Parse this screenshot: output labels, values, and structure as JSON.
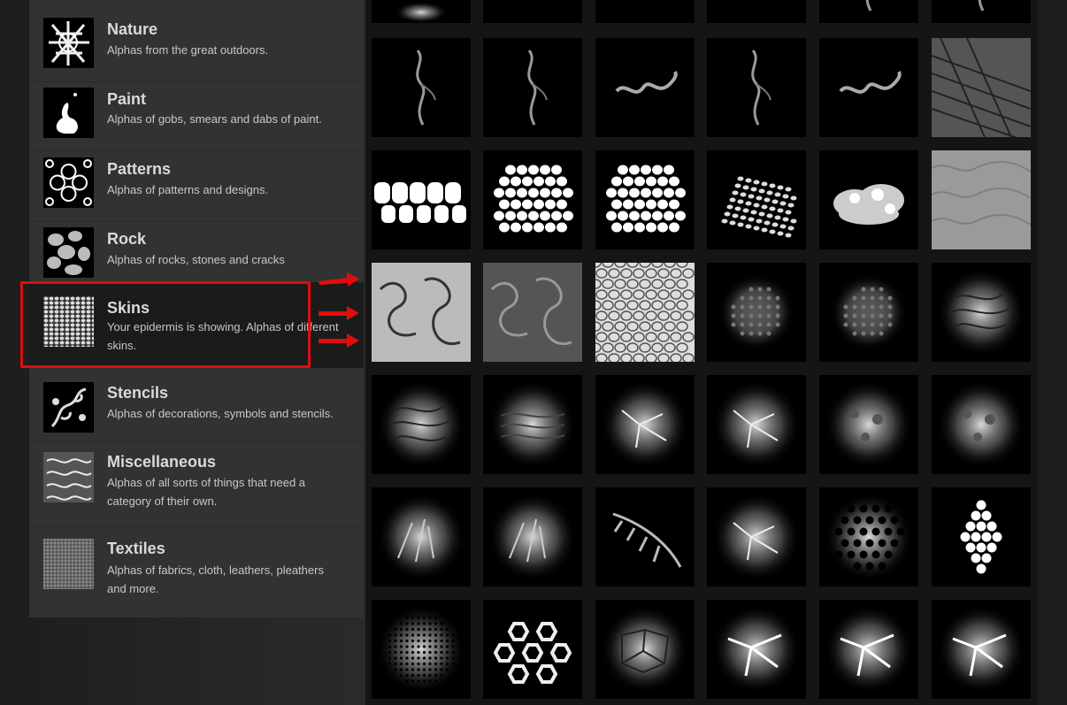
{
  "categories": [
    {
      "id": "nature",
      "title": "Nature",
      "desc": "Alphas from the great outdoors.",
      "icon": "nature-thumb"
    },
    {
      "id": "paint",
      "title": "Paint",
      "desc": "Alphas of gobs, smears and dabs of paint.",
      "icon": "paint-thumb"
    },
    {
      "id": "patterns",
      "title": "Patterns",
      "desc": "Alphas of patterns and designs.",
      "icon": "patterns-thumb"
    },
    {
      "id": "rock",
      "title": "Rock",
      "desc": "Alphas of rocks, stones and cracks",
      "icon": "rock-thumb"
    },
    {
      "id": "skins",
      "title": "Skins",
      "desc": "Your epidermis is showing. Alphas of different skins.",
      "icon": "skins-thumb",
      "selected": true
    },
    {
      "id": "stencils",
      "title": "Stencils",
      "desc": "Alphas of decorations, symbols and stencils.",
      "icon": "stencils-thumb"
    },
    {
      "id": "misc",
      "title": "Miscellaneous",
      "desc": "Alphas of all sorts of things that need a category of their own.",
      "icon": "misc-thumb"
    },
    {
      "id": "textiles",
      "title": "Textiles",
      "desc": "Alphas of fabrics, cloth, leathers, pleathers and more.",
      "icon": "textiles-thumb"
    }
  ],
  "annotation": {
    "highlight_color": "#e00d0d",
    "arrow_color": "#e00d0d",
    "arrow_count": 3
  },
  "grid": {
    "columns": 6,
    "rows": [
      [
        "glow",
        "blank",
        "blank",
        "blank",
        "vein",
        "vein"
      ],
      [
        "vein",
        "vein",
        "worm",
        "vein",
        "worm",
        "creased-skin"
      ],
      [
        "pebbles",
        "cells",
        "cells",
        "scales",
        "clouds",
        "gray-noise"
      ],
      [
        "swirl-white",
        "swirl-gray",
        "mesh",
        "dots-faint",
        "dots-faint",
        "fingerprint"
      ],
      [
        "fingerprint",
        "ripples",
        "cracks",
        "cracks",
        "mottled",
        "mottled"
      ],
      [
        "fur",
        "fur",
        "feather",
        "cracks",
        "honeycomb",
        "diamond-dots"
      ],
      [
        "dots-fine",
        "hex-rings",
        "cells-soft",
        "web",
        "web",
        "web"
      ]
    ]
  }
}
